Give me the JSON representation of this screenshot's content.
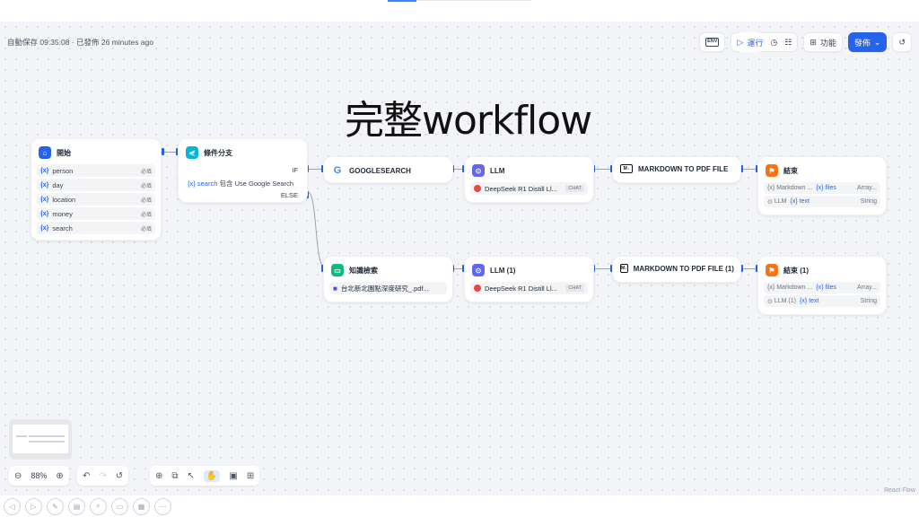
{
  "status": {
    "autosave_text": "自動保存 09:35:08 · 已發佈 26 minutes ago"
  },
  "toolbar": {
    "env_label": "ENV",
    "run_label": "運行",
    "features_label": "功能",
    "publish_label": "發佈"
  },
  "canvas_title": "完整workflow",
  "nodes": {
    "start": {
      "title": "開始",
      "vars": [
        {
          "name": "person",
          "tag": "必填"
        },
        {
          "name": "day",
          "tag": "必填"
        },
        {
          "name": "location",
          "tag": "必填"
        },
        {
          "name": "money",
          "tag": "必填"
        },
        {
          "name": "search",
          "tag": "必填"
        }
      ]
    },
    "condition": {
      "title": "條件分支",
      "if_label": "IF",
      "else_label": "ELSE",
      "cond_var": "search",
      "cond_op": "包含",
      "cond_value": "Use Google Search"
    },
    "google": {
      "title": "GOOGLESEARCH"
    },
    "llm1": {
      "title": "LLM",
      "model": "DeepSeek R1 Distill Ll...",
      "mode": "CHAT"
    },
    "pdf1": {
      "title": "MARKDOWN TO PDF FILE"
    },
    "end1": {
      "title": "結束",
      "rows": [
        {
          "src": "Markdown ...",
          "var": "files",
          "type": "Array..."
        },
        {
          "src": "LLM",
          "var": "text",
          "type": "String"
        }
      ]
    },
    "knowledge": {
      "title": "知識檢索",
      "doc": "台北新北園點深度研究_.pdf..."
    },
    "llm2": {
      "title": "LLM (1)",
      "model": "DeepSeek R1 Distill Ll...",
      "mode": "CHAT"
    },
    "pdf2": {
      "title": "MARKDOWN TO PDF FILE (1)"
    },
    "end2": {
      "title": "結束 (1)",
      "rows": [
        {
          "src": "Markdown ...",
          "var": "files",
          "type": "Array..."
        },
        {
          "src": "LLM (1)",
          "var": "text",
          "type": "String"
        }
      ]
    }
  },
  "zoom": {
    "level": "88%"
  },
  "footer": {
    "reactflow_label": "React Flow"
  },
  "icons": {
    "start": "home-icon",
    "condition": "branch-icon",
    "google": "google-icon",
    "llm": "llm-icon",
    "pdf": "markdown-icon",
    "end": "end-icon",
    "knowledge": "book-icon"
  }
}
